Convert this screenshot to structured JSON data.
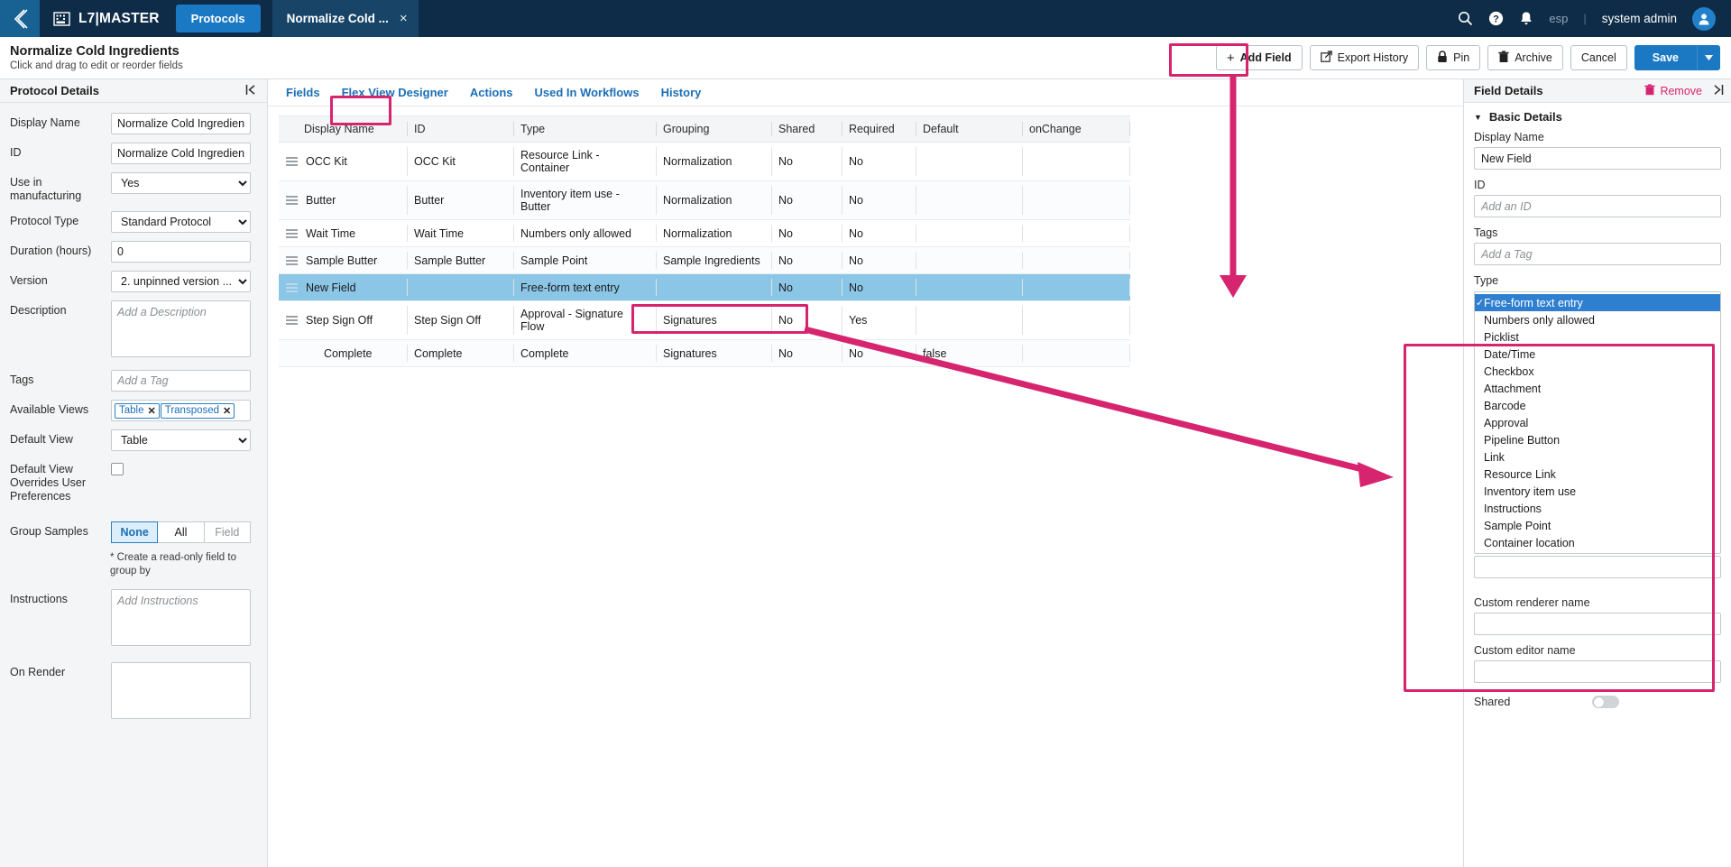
{
  "topnav": {
    "back_icon": "chevron-left-icon",
    "brand_icon": "building-icon",
    "brand": "L7|MASTER",
    "protocols_label": "Protocols",
    "tab_label": "Normalize Cold ...",
    "tab_close": "×",
    "search_icon": "search-icon",
    "help_icon": "help-circle-icon",
    "bell_icon": "bell-icon",
    "locale": "esp",
    "divider": "|",
    "user": "system admin",
    "avatar_icon": "user-avatar-icon"
  },
  "pagehead": {
    "title": "Normalize Cold Ingredients",
    "subtitle": "Click and drag to edit or reorder fields",
    "add_field": "Add Field",
    "export_history": "Export History",
    "pin": "Pin",
    "archive": "Archive",
    "cancel": "Cancel",
    "save": "Save",
    "save_caret": "▼"
  },
  "sidebar": {
    "title": "Protocol Details",
    "collapse_icon": "collapse-panel-icon",
    "fields": {
      "display_name_label": "Display Name",
      "display_name_value": "Normalize Cold Ingredient",
      "id_label": "ID",
      "id_value": "Normalize Cold Ingredient",
      "use_in_manufacturing_label": "Use in manufacturing",
      "use_in_manufacturing_value": "Yes",
      "protocol_type_label": "Protocol Type",
      "protocol_type_value": "Standard Protocol",
      "duration_label": "Duration (hours)",
      "duration_value": "0",
      "version_label": "Version",
      "version_value": "2. unpinned version ...",
      "description_label": "Description",
      "description_placeholder": "Add a Description",
      "tags_label": "Tags",
      "tags_placeholder": "Add a Tag",
      "available_views_label": "Available Views",
      "available_views": [
        "Table",
        "Transposed"
      ],
      "default_view_label": "Default View",
      "default_view_value": "Table",
      "overrides_label": "Default View Overrides User Preferences",
      "group_samples_label": "Group Samples",
      "group_samples_options": [
        "None",
        "All",
        "Field"
      ],
      "group_samples_selected": "None",
      "group_samples_hint": "* Create a read-only field to group by",
      "instructions_label": "Instructions",
      "instructions_placeholder": "Add Instructions",
      "on_render_label": "On Render"
    }
  },
  "tabs": [
    {
      "label": "Fields",
      "active": true
    },
    {
      "label": "Flex View Designer",
      "active": false
    },
    {
      "label": "Actions",
      "active": false
    },
    {
      "label": "Used In Workflows",
      "active": false
    },
    {
      "label": "History",
      "active": false
    }
  ],
  "table": {
    "columns": [
      "Display Name",
      "ID",
      "Type",
      "Grouping",
      "Shared",
      "Required",
      "Default",
      "onChange"
    ],
    "rows": [
      {
        "display_name": "OCC Kit",
        "id": "OCC Kit",
        "type": "Resource Link - Container",
        "grouping": "Normalization",
        "shared": "No",
        "required": "No",
        "default": "",
        "onchange": "",
        "selected": false
      },
      {
        "display_name": "Butter",
        "id": "Butter",
        "type": "Inventory item use - Butter",
        "grouping": "Normalization",
        "shared": "No",
        "required": "No",
        "default": "",
        "onchange": "",
        "selected": false
      },
      {
        "display_name": "Wait Time",
        "id": "Wait Time",
        "type": "Numbers only allowed",
        "grouping": "Normalization",
        "shared": "No",
        "required": "No",
        "default": "",
        "onchange": "",
        "selected": false
      },
      {
        "display_name": "Sample Butter",
        "id": "Sample Butter",
        "type": "Sample Point",
        "grouping": "Sample Ingredients",
        "shared": "No",
        "required": "No",
        "default": "",
        "onchange": "",
        "selected": false
      },
      {
        "display_name": "New Field",
        "id": "",
        "type": "Free-form text entry",
        "grouping": "",
        "shared": "No",
        "required": "No",
        "default": "",
        "onchange": "",
        "selected": true
      },
      {
        "display_name": "Step Sign Off",
        "id": "Step Sign Off",
        "type": "Approval - Signature Flow",
        "grouping": "Signatures",
        "shared": "No",
        "required": "Yes",
        "default": "",
        "onchange": "",
        "selected": false
      },
      {
        "display_name": "Complete",
        "id": "Complete",
        "type": "Complete",
        "grouping": "Signatures",
        "shared": "No",
        "required": "No",
        "default": "false",
        "onchange": "",
        "selected": false
      }
    ]
  },
  "field_details": {
    "title": "Field Details",
    "remove_label": "Remove",
    "remove_icon": "trash-icon",
    "expand_icon": "expand-panel-icon",
    "section_label": "Basic Details",
    "section_caret": "▼",
    "display_name_label": "Display Name",
    "display_name_value": "New Field",
    "id_label": "ID",
    "id_placeholder": "Add an ID",
    "tags_label": "Tags",
    "tags_placeholder": "Add a Tag",
    "type_label": "Type",
    "type_selected": "Free-form text entry",
    "type_options": [
      "Free-form text entry",
      "Numbers only allowed",
      "Picklist",
      "Date/Time",
      "Checkbox",
      "Attachment",
      "Barcode",
      "Approval",
      "Pipeline Button",
      "Link",
      "Resource Link",
      "Inventory item use",
      "Instructions",
      "Sample Point",
      "Container location"
    ],
    "custom_renderer_label": "Custom renderer name",
    "custom_renderer_value": "",
    "custom_editor_label": "Custom editor name",
    "custom_editor_value": "",
    "shared_label": "Shared"
  },
  "colors": {
    "accent_pink": "#d6246e",
    "nav_bg": "#0e2c47",
    "primary_blue": "#1b78c2",
    "selected_row": "#8cc6e6"
  }
}
